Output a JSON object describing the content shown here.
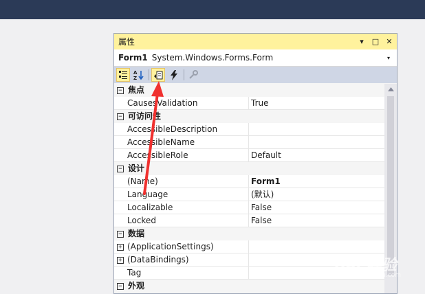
{
  "panel": {
    "title": "属性",
    "title_buttons": [
      "▾",
      "□",
      "✕"
    ],
    "object_name": "Form1",
    "object_type": "System.Windows.Forms.Form",
    "object_dropdown": "▾"
  },
  "toolbar": {
    "buttons": [
      {
        "icon": "categorized-icon",
        "active": true
      },
      {
        "icon": "alphabetical-sort-icon",
        "active": false
      },
      {
        "icon": "properties-icon",
        "active": true
      },
      {
        "icon": "events-lightning-icon",
        "active": false
      },
      {
        "icon": "property-pages-wrench-icon",
        "active": false
      }
    ]
  },
  "grid": {
    "categories": [
      {
        "label": "焦点",
        "expander": "⊟",
        "properties": [
          {
            "name": "CausesValidation",
            "value": "True"
          }
        ]
      },
      {
        "label": "可访问性",
        "expander": "⊟",
        "properties": [
          {
            "name": "AccessibleDescription",
            "value": ""
          },
          {
            "name": "AccessibleName",
            "value": ""
          },
          {
            "name": "AccessibleRole",
            "value": "Default"
          }
        ]
      },
      {
        "label": "设计",
        "expander": "⊟",
        "properties": [
          {
            "name": "(Name)",
            "value": "Form1"
          },
          {
            "name": "Language",
            "value": "(默认)"
          },
          {
            "name": "Localizable",
            "value": "False"
          },
          {
            "name": "Locked",
            "value": "False"
          }
        ]
      },
      {
        "label": "数据",
        "expander": "⊟",
        "properties": [
          {
            "name": "(ApplicationSettings)",
            "value": "",
            "expander": "+"
          },
          {
            "name": "(DataBindings)",
            "value": "",
            "expander": "+"
          },
          {
            "name": "Tag",
            "value": ""
          }
        ]
      },
      {
        "label": "外观",
        "expander": "⊟",
        "properties": []
      }
    ]
  },
  "watermark": {
    "brand": "Bai 经验",
    "sub": "jingyan.baidu.com"
  },
  "colors": {
    "title_bar": "#fff29d",
    "toolbar": "#cfd6e5",
    "top_band": "#2b3a57",
    "annotation_arrow": "#f0312f"
  }
}
